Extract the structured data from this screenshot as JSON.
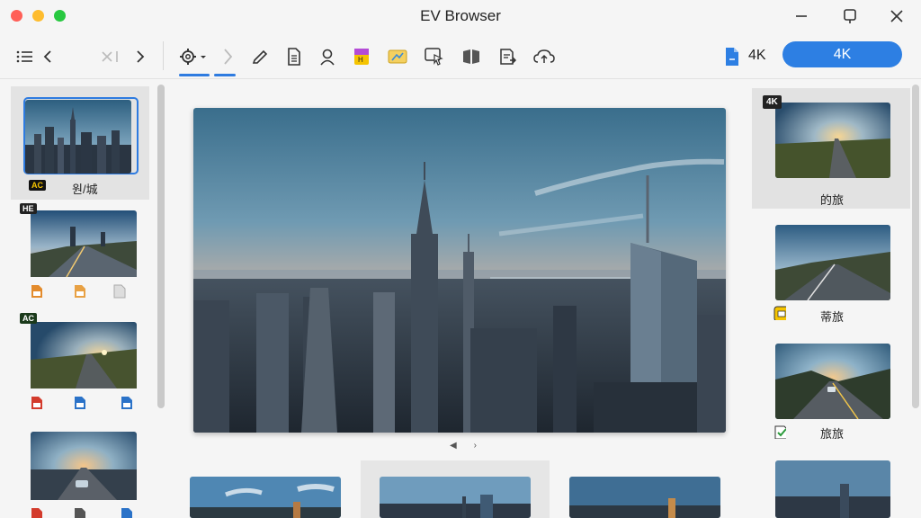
{
  "window": {
    "title": "EV Browser"
  },
  "toolbar": {
    "icons": [
      "list-icon",
      "back-icon",
      "prev-disabled-icon",
      "forward-icon",
      "settings-icon",
      "chevron-icon",
      "edit-icon",
      "document-icon",
      "person-icon",
      "badge-icon",
      "image-card-icon",
      "select-icon",
      "book-icon",
      "export-icon",
      "cloud-icon",
      "file-icon"
    ],
    "resolution_label": "4K",
    "resolution_button": "4K",
    "accent": "#2d7fe3"
  },
  "left_panel": {
    "items": [
      {
        "badge": "AC",
        "label": "원/城",
        "selected": true
      },
      {
        "badge": "HE",
        "label": "",
        "selected": false
      },
      {
        "badge": "AC",
        "label": "",
        "selected": false
      },
      {
        "badge": "",
        "label": "",
        "selected": false
      }
    ]
  },
  "main": {
    "pager_prev": "◀",
    "pager_next": "›"
  },
  "right_panel": {
    "items": [
      {
        "badge": "4K",
        "label": "的旅",
        "selected": true
      },
      {
        "badge": "",
        "label": "蒂旅",
        "selected": false
      },
      {
        "badge": "",
        "label": "旅旅",
        "selected": false
      },
      {
        "badge": "",
        "label": "",
        "selected": false
      }
    ]
  }
}
